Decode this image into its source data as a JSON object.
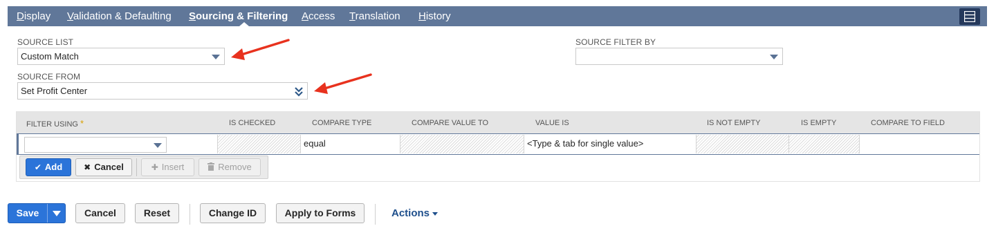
{
  "tabs": [
    {
      "label": "Display",
      "underline": "D",
      "rest": "isplay"
    },
    {
      "label": "Validation & Defaulting",
      "underline": "V",
      "rest": "alidation & Defaulting"
    },
    {
      "label": "Sourcing & Filtering",
      "underline": "S",
      "rest": "ourcing & Filtering"
    },
    {
      "label": "Access",
      "underline": "A",
      "rest": "ccess"
    },
    {
      "label": "Translation",
      "underline": "T",
      "rest": "ranslation"
    },
    {
      "label": "History",
      "underline": "H",
      "rest": "istory"
    }
  ],
  "active_tab": "Sourcing & Filtering",
  "fields": {
    "source_list": {
      "label": "SOURCE LIST",
      "value": "Custom Match"
    },
    "source_from": {
      "label": "SOURCE FROM",
      "value": "Set Profit Center"
    },
    "source_filter_by": {
      "label": "SOURCE FILTER BY",
      "value": ""
    }
  },
  "sublist": {
    "columns": [
      {
        "label": "FILTER USING",
        "required": true
      },
      {
        "label": "IS CHECKED"
      },
      {
        "label": "COMPARE TYPE"
      },
      {
        "label": "COMPARE VALUE TO"
      },
      {
        "label": "VALUE IS"
      },
      {
        "label": "IS NOT EMPTY"
      },
      {
        "label": "IS EMPTY"
      },
      {
        "label": "COMPARE TO FIELD"
      }
    ],
    "row": {
      "filter_using": "",
      "compare_type": "equal",
      "value_is": "<Type & tab for single value>"
    },
    "buttons": {
      "add": "Add",
      "cancel": "Cancel",
      "insert": "Insert",
      "remove": "Remove"
    }
  },
  "footer": {
    "save": "Save",
    "cancel": "Cancel",
    "reset": "Reset",
    "change_id": "Change ID",
    "apply_to_forms": "Apply to Forms",
    "actions": "Actions"
  },
  "colors": {
    "tabbar": "#607799",
    "primary_button": "#2b74d9",
    "annotation_arrow": "#e8321e"
  }
}
